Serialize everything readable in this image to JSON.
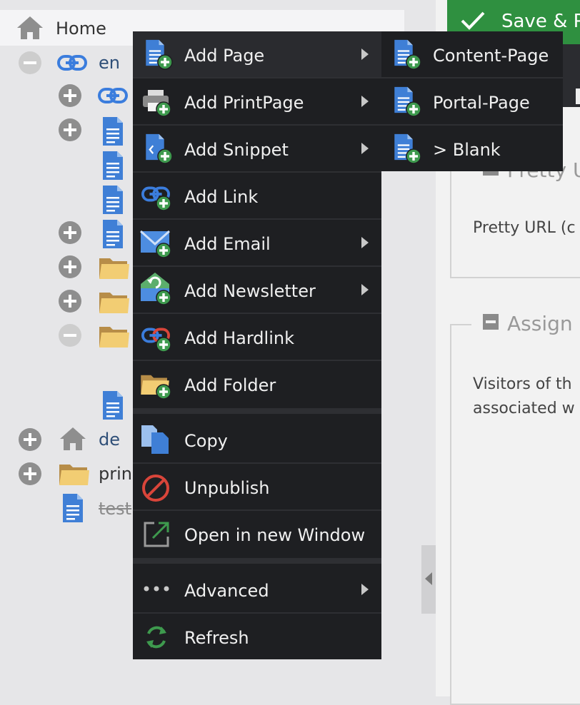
{
  "tree": {
    "home_label": "Home",
    "nodes": [
      {
        "label": "en"
      },
      {
        "label": "de"
      },
      {
        "label": "prin"
      },
      {
        "label": "test"
      }
    ]
  },
  "right_panel": {
    "save_label": "Save & P",
    "section1_legend": "Pretty U",
    "section1_text": "Pretty URL (c",
    "section2_legend": "Assign",
    "section2_text_line1": "Visitors of th",
    "section2_text_line2": "associated w"
  },
  "context_menu": {
    "items": [
      {
        "label": "Add Page",
        "icon": "add-page-icon",
        "has_submenu": true
      },
      {
        "label": "Add PrintPage",
        "icon": "add-printpage-icon",
        "has_submenu": true
      },
      {
        "label": "Add Snippet",
        "icon": "add-snippet-icon",
        "has_submenu": true
      },
      {
        "label": "Add Link",
        "icon": "add-link-icon",
        "has_submenu": false
      },
      {
        "label": "Add Email",
        "icon": "add-email-icon",
        "has_submenu": true
      },
      {
        "label": "Add Newsletter",
        "icon": "add-newsletter-icon",
        "has_submenu": true
      },
      {
        "label": "Add Hardlink",
        "icon": "add-hardlink-icon",
        "has_submenu": false
      },
      {
        "label": "Add Folder",
        "icon": "add-folder-icon",
        "has_submenu": false
      },
      {
        "label": "Copy",
        "icon": "copy-icon",
        "has_submenu": false
      },
      {
        "label": "Unpublish",
        "icon": "unpublish-icon",
        "has_submenu": false
      },
      {
        "label": "Open in new Window",
        "icon": "open-new-window-icon",
        "has_submenu": false
      },
      {
        "label": "Advanced",
        "icon": "more-icon",
        "has_submenu": true
      },
      {
        "label": "Refresh",
        "icon": "refresh-icon",
        "has_submenu": false
      }
    ]
  },
  "submenu": {
    "items": [
      {
        "label": "Content-Page",
        "icon": "add-page-icon"
      },
      {
        "label": "Portal-Page",
        "icon": "add-page-icon"
      },
      {
        "label": "> Blank",
        "icon": "add-page-icon"
      }
    ]
  },
  "colors": {
    "menu_bg": "#1e1f22",
    "accent_green": "#2f9040",
    "doc_blue": "#3f7fd6",
    "folder_tan": "#d9b874",
    "link_blue": "#3b7ddd"
  }
}
